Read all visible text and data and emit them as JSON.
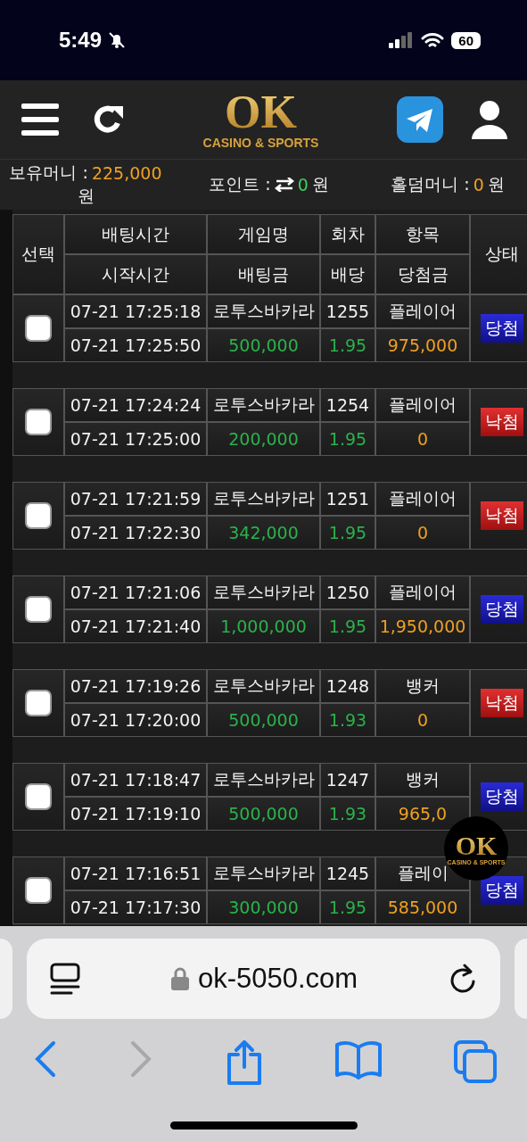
{
  "status_bar": {
    "time": "5:49",
    "battery": "60"
  },
  "header": {
    "logo": {
      "title": "OK",
      "subtitle": "CASINO & SPORTS"
    }
  },
  "balances": [
    {
      "kind": "money",
      "label": "보유머니 :",
      "value": "225,000",
      "unit": "원",
      "color": "#f0a020"
    },
    {
      "kind": "point",
      "label": "포인트 :",
      "value": "0",
      "unit": "원",
      "color": "#3fd05a"
    },
    {
      "kind": "money",
      "label": "홀덤머니 :",
      "value": "0",
      "unit": "원",
      "color": "#f0a020"
    }
  ],
  "table": {
    "select_header": "선택",
    "status_header": "상태",
    "top_headers": [
      "배팅시간",
      "게임명",
      "회차",
      "항목"
    ],
    "bottom_headers": [
      "시작시간",
      "배팅금",
      "배당",
      "당첨금"
    ],
    "rows": [
      {
        "checked": false,
        "bet_time": "07-21 17:25:18",
        "game": "로투스바카라",
        "round": "1255",
        "pick": "플레이어",
        "start_time": "07-21 17:25:50",
        "amount": "500,000",
        "odds": "1.95",
        "payout": "975,000",
        "status": "당첨",
        "kind": "win"
      },
      {
        "checked": false,
        "bet_time": "07-21 17:24:24",
        "game": "로투스바카라",
        "round": "1254",
        "pick": "플레이어",
        "start_time": "07-21 17:25:00",
        "amount": "200,000",
        "odds": "1.95",
        "payout": "0",
        "status": "낙첨",
        "kind": "lose"
      },
      {
        "checked": false,
        "bet_time": "07-21 17:21:59",
        "game": "로투스바카라",
        "round": "1251",
        "pick": "플레이어",
        "start_time": "07-21 17:22:30",
        "amount": "342,000",
        "odds": "1.95",
        "payout": "0",
        "status": "낙첨",
        "kind": "lose"
      },
      {
        "checked": false,
        "bet_time": "07-21 17:21:06",
        "game": "로투스바카라",
        "round": "1250",
        "pick": "플레이어",
        "start_time": "07-21 17:21:40",
        "amount": "1,000,000",
        "odds": "1.95",
        "payout": "1,950,000",
        "status": "당첨",
        "kind": "win"
      },
      {
        "checked": false,
        "bet_time": "07-21 17:19:26",
        "game": "로투스바카라",
        "round": "1248",
        "pick": "뱅커",
        "start_time": "07-21 17:20:00",
        "amount": "500,000",
        "odds": "1.93",
        "payout": "0",
        "status": "낙첨",
        "kind": "lose"
      },
      {
        "checked": false,
        "bet_time": "07-21 17:18:47",
        "game": "로투스바카라",
        "round": "1247",
        "pick": "뱅커",
        "start_time": "07-21 17:19:10",
        "amount": "500,000",
        "odds": "1.93",
        "payout": "965,0",
        "status": "당첨",
        "kind": "win"
      },
      {
        "checked": false,
        "bet_time": "07-21 17:16:51",
        "game": "로투스바카라",
        "round": "1245",
        "pick": "플레이",
        "start_time": "07-21 17:17:30",
        "amount": "300,000",
        "odds": "1.95",
        "payout": "585,000",
        "status": "당첨",
        "kind": "win"
      }
    ]
  },
  "floating_badge": {
    "title": "OK",
    "subtitle": "CASINO & SPORTS"
  },
  "browser": {
    "url": "ok-5050.com"
  }
}
